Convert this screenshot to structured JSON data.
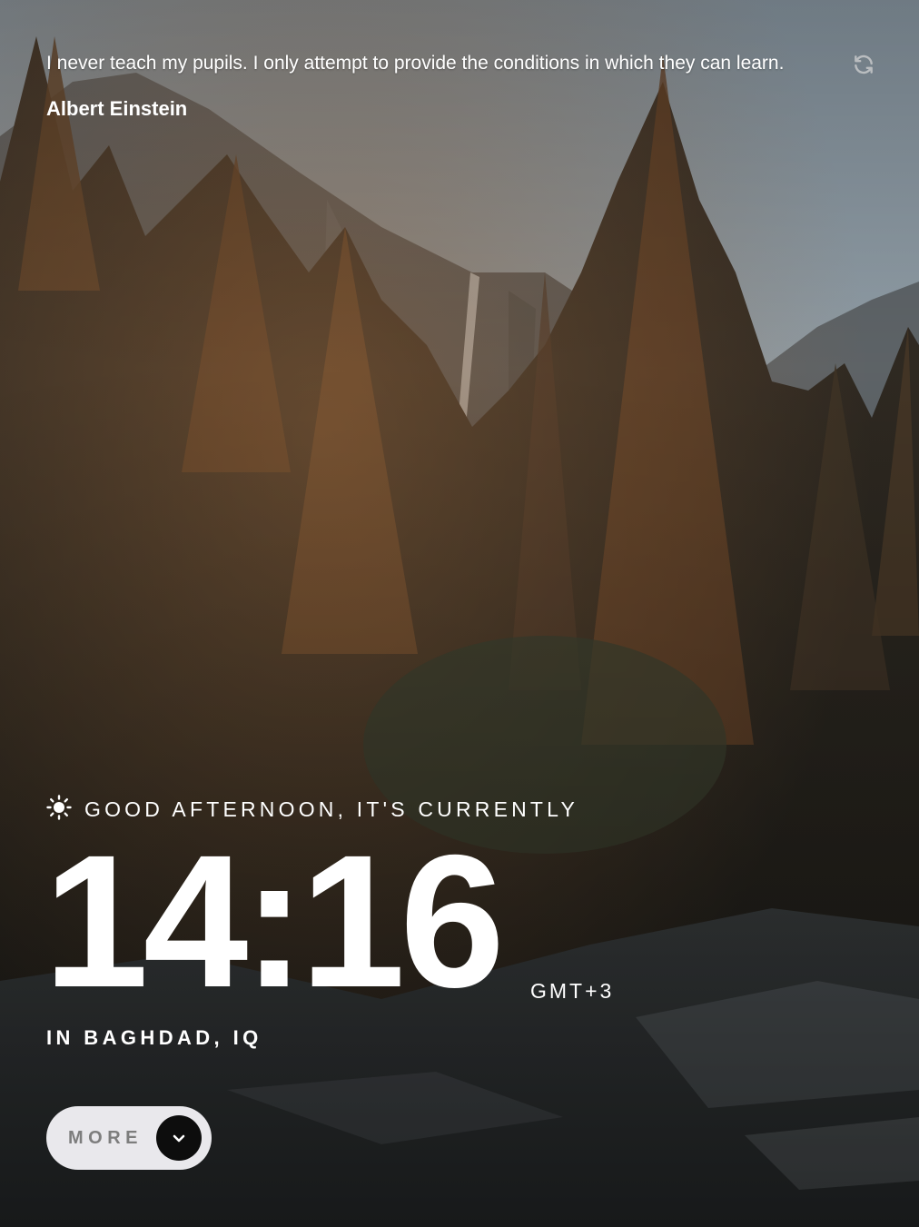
{
  "quote": {
    "text": "I never teach my pupils. I only attempt to provide the conditions in which they can learn.",
    "author": "Albert Einstein"
  },
  "clock": {
    "greeting": "GOOD AFTERNOON, IT'S CURRENTLY",
    "time": "14:16",
    "timezone": "GMT+3",
    "location": "IN BAGHDAD, IQ"
  },
  "more_button": {
    "label": "MORE"
  },
  "icons": {
    "refresh": "refresh-icon",
    "greeting": "sun-icon",
    "more": "chevron-down-icon"
  },
  "colors": {
    "text": "#ffffff",
    "button_bg": "#e9e8ec",
    "button_text": "#7d7d7d",
    "button_icon_bg": "#0d0d0d"
  }
}
